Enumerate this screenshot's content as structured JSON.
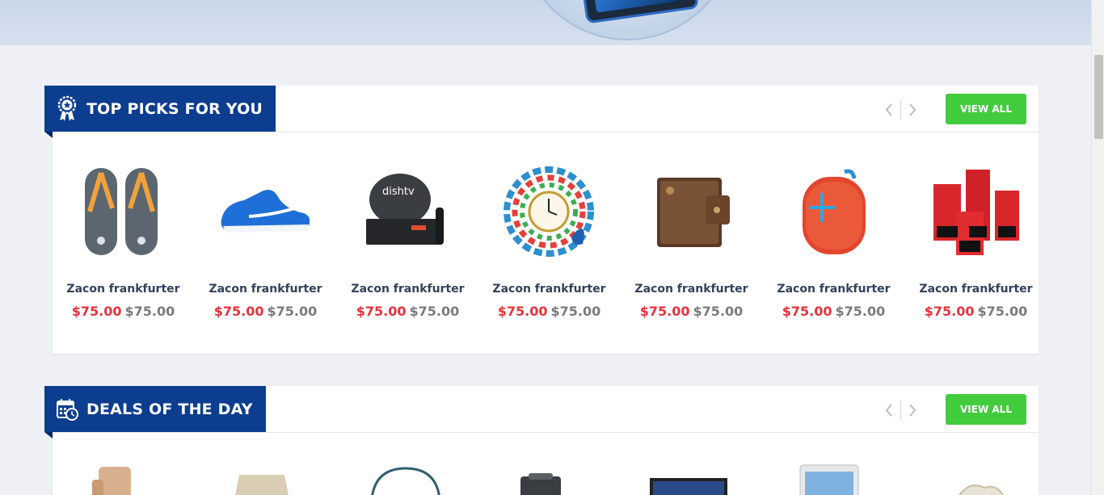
{
  "sections": {
    "top_picks": {
      "title": "TOP PICKS FOR YOU",
      "view_all_label": "VIEW ALL",
      "products": [
        {
          "name": "Zacon frankfurter",
          "price": "$75.00",
          "old_price": "$75.00",
          "icon": "flip-flops-icon"
        },
        {
          "name": "Zacon frankfurter",
          "price": "$75.00",
          "old_price": "$75.00",
          "icon": "running-shoe-icon"
        },
        {
          "name": "Zacon frankfurter",
          "price": "$75.00",
          "old_price": "$75.00",
          "icon": "dish-tv-icon"
        },
        {
          "name": "Zacon frankfurter",
          "price": "$75.00",
          "old_price": "$75.00",
          "icon": "peacock-clock-icon"
        },
        {
          "name": "Zacon frankfurter",
          "price": "$75.00",
          "old_price": "$75.00",
          "icon": "wallet-icon"
        },
        {
          "name": "Zacon frankfurter",
          "price": "$75.00",
          "old_price": "$75.00",
          "icon": "speaker-icon"
        },
        {
          "name": "Zacon frankfurter",
          "price": "$75.00",
          "old_price": "$75.00",
          "icon": "candles-icon"
        }
      ]
    },
    "deals": {
      "title": "DEALS OF THE DAY",
      "view_all_label": "VIEW ALL",
      "items": [
        "chair-icon",
        "lamp-icon",
        "bag-icon",
        "backpack-icon",
        "laptop-icon",
        "tablet-icon",
        "basket-icon"
      ]
    }
  },
  "colors": {
    "title_tab": "#0c3d8f",
    "view_all": "#43cb3e",
    "price_new": "#e8323c",
    "price_old": "#7b7b7b"
  }
}
